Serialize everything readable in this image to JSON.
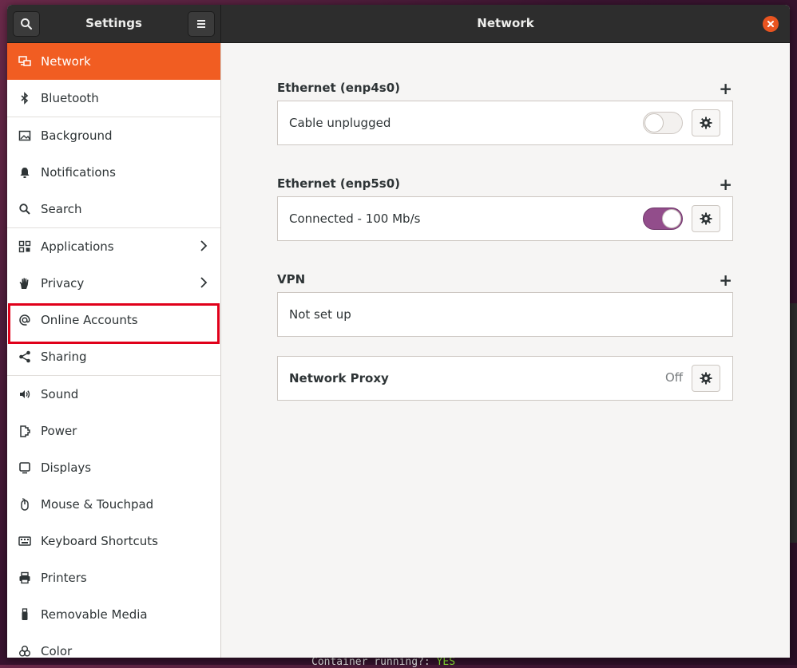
{
  "window": {
    "sidebar_title": "Settings",
    "panel_title": "Network"
  },
  "sidebar": {
    "items": [
      {
        "label": "Network",
        "icon": "network-icon",
        "active": true
      },
      {
        "label": "Bluetooth",
        "icon": "bluetooth-icon"
      },
      {
        "label": "Background",
        "icon": "image-icon"
      },
      {
        "label": "Notifications",
        "icon": "bell-icon"
      },
      {
        "label": "Search",
        "icon": "search-icon"
      },
      {
        "label": "Applications",
        "icon": "grid-icon",
        "chevron": true
      },
      {
        "label": "Privacy",
        "icon": "hand-icon",
        "chevron": true,
        "highlighted": true
      },
      {
        "label": "Online Accounts",
        "icon": "at-icon"
      },
      {
        "label": "Sharing",
        "icon": "share-icon"
      },
      {
        "label": "Sound",
        "icon": "speaker-icon"
      },
      {
        "label": "Power",
        "icon": "power-icon"
      },
      {
        "label": "Displays",
        "icon": "display-icon"
      },
      {
        "label": "Mouse & Touchpad",
        "icon": "mouse-icon"
      },
      {
        "label": "Keyboard Shortcuts",
        "icon": "keyboard-icon"
      },
      {
        "label": "Printers",
        "icon": "printer-icon"
      },
      {
        "label": "Removable Media",
        "icon": "usb-icon"
      },
      {
        "label": "Color",
        "icon": "color-icon"
      }
    ]
  },
  "network": {
    "ethernet1": {
      "title": "Ethernet (enp4s0)",
      "status": "Cable unplugged",
      "enabled": false
    },
    "ethernet2": {
      "title": "Ethernet (enp5s0)",
      "status": "Connected - 100 Mb/s",
      "enabled": true
    },
    "vpn": {
      "title": "VPN",
      "status": "Not set up"
    },
    "proxy": {
      "title": "Network Proxy",
      "value": "Off"
    },
    "add_symbol": "+"
  },
  "background_terminal": {
    "text": "Container running?: ",
    "value": "YES"
  },
  "colors": {
    "accent": "#f15d22",
    "toggle_on": "#924d8b",
    "highlight": "#e0001a"
  }
}
